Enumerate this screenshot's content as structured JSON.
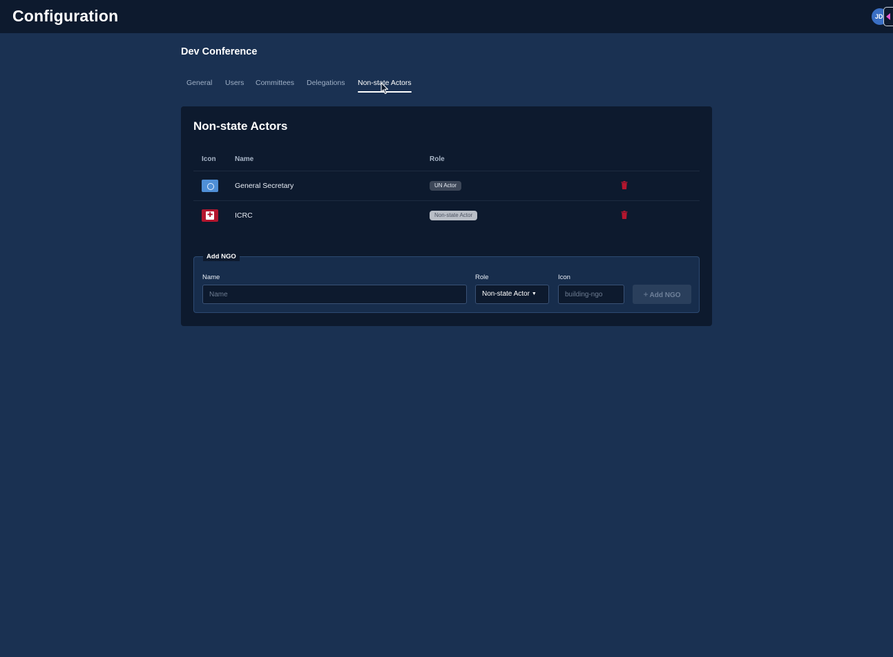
{
  "app": {
    "title": "Configuration",
    "user_initials": "JD"
  },
  "conference": {
    "name": "Dev Conference"
  },
  "tabs": [
    {
      "label": "General",
      "active": false
    },
    {
      "label": "Users",
      "active": false
    },
    {
      "label": "Committees",
      "active": false
    },
    {
      "label": "Delegations",
      "active": false
    },
    {
      "label": "Non-state Actors",
      "active": true
    }
  ],
  "card": {
    "title": "Non-state Actors",
    "columns": {
      "icon": "Icon",
      "name": "Name",
      "role": "Role"
    },
    "rows": [
      {
        "icon": "un-flag-icon",
        "name": "General Secretary",
        "role": "UN Actor"
      },
      {
        "icon": "icrc-flag-icon",
        "name": "ICRC",
        "role": "Non-state Actor"
      }
    ]
  },
  "add_form": {
    "legend": "Add NGO",
    "name_label": "Name",
    "name_placeholder": "Name",
    "role_label": "Role",
    "role_value": "Non-state Actor",
    "icon_label": "Icon",
    "icon_placeholder": "building-ngo",
    "submit_label": "Add NGO"
  },
  "colors": {
    "page_bg": "#1a3152",
    "panel_bg": "#0d1a2e",
    "delete": "#b3162e",
    "accent_arrow": "#e65ad0"
  }
}
